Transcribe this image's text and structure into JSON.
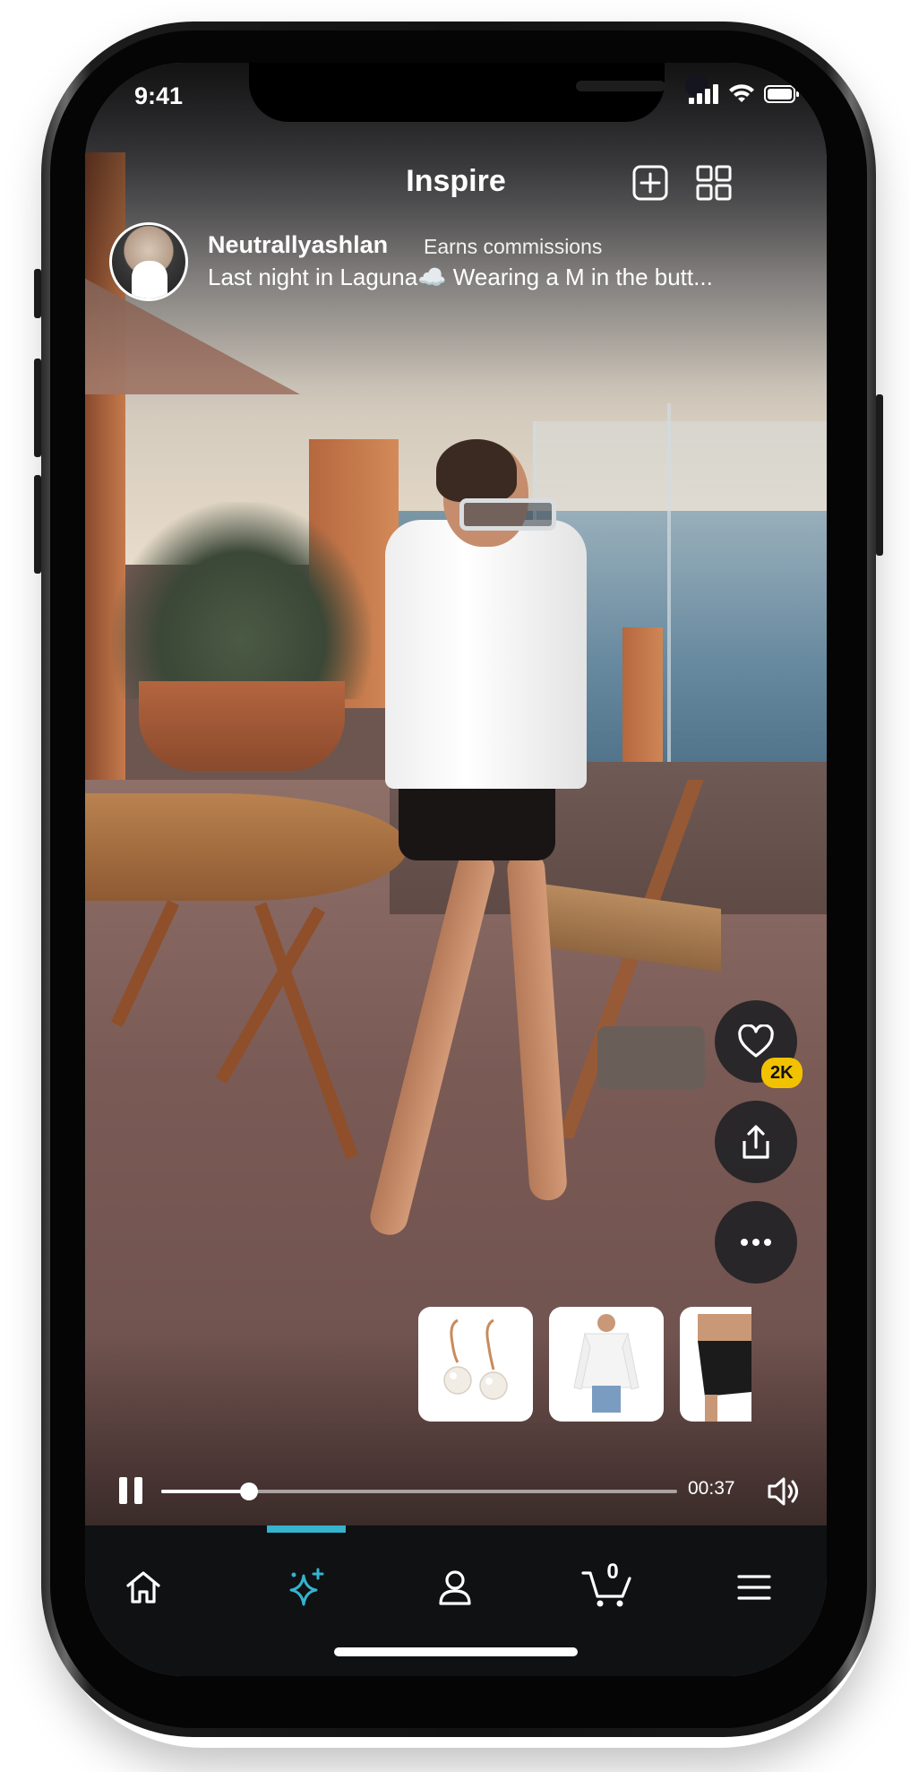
{
  "status": {
    "time": "9:41"
  },
  "header": {
    "title": "Inspire",
    "add_icon": "plus-square-icon",
    "grid_icon": "grid-icon"
  },
  "creator": {
    "name": "Neutrallyashlan",
    "badge": "Earns commissions",
    "caption": "Last night in Laguna☁️ Wearing a M in the butt..."
  },
  "actions": {
    "like_icon": "heart-icon",
    "like_count": "2K",
    "share_icon": "share-icon",
    "more_icon": "more-icon"
  },
  "products": [
    {
      "name": "pearl-earrings"
    },
    {
      "name": "white-shirt"
    },
    {
      "name": "black-skirt"
    }
  ],
  "player": {
    "time": "00:37",
    "progress_fraction": 0.17,
    "state": "playing"
  },
  "nav": {
    "cart_count": "0",
    "active": "inspire",
    "accent": "#35b3cf",
    "items": [
      "home-icon",
      "inspire-sparkle-icon",
      "account-icon",
      "cart-icon",
      "menu-icon"
    ]
  },
  "colors": {
    "badge": "#f2c200",
    "accent": "#35b3cf"
  }
}
